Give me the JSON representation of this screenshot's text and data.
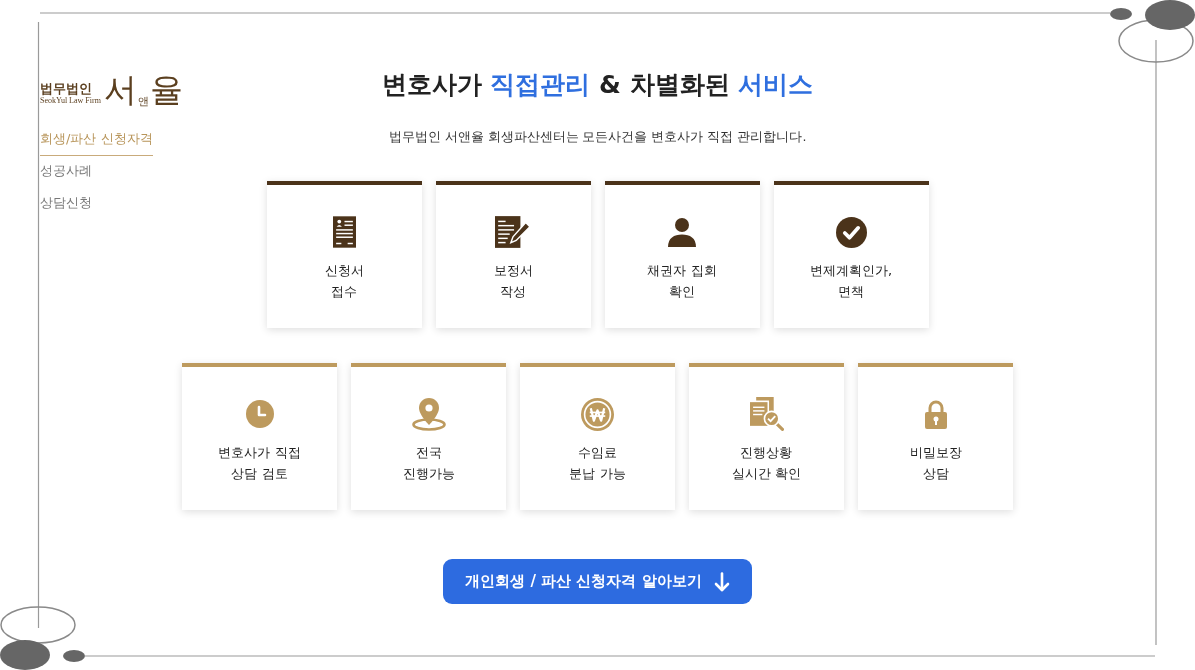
{
  "logo": {
    "firm_type": "법무법인",
    "english_name": "SeokYul Law Firm",
    "name_chars": [
      {
        "text": "서",
        "kind": "large"
      },
      {
        "text": "앤",
        "kind": "small"
      },
      {
        "text": "율",
        "kind": "large"
      }
    ]
  },
  "sidebar": {
    "items": [
      {
        "label": "회생/파산 신청자격",
        "selected": true
      },
      {
        "label": "성공사례",
        "selected": false
      },
      {
        "label": "상담신청",
        "selected": false
      }
    ]
  },
  "heading": {
    "segments": [
      {
        "text": "변호사가 ",
        "highlight": false
      },
      {
        "text": "직접관리",
        "highlight": true
      },
      {
        "text": " & 차별화된 ",
        "highlight": false
      },
      {
        "text": "서비스",
        "highlight": true
      }
    ]
  },
  "subtitle": "법무법인 서앤율 회생파산센터는 모든사건을 변호사가 직접 관리합니다.",
  "card_rows": [
    {
      "kind": "primary",
      "cards": [
        {
          "lines": [
            "신청서",
            "접수"
          ]
        },
        {
          "lines": [
            "보정서",
            "작성"
          ]
        },
        {
          "lines": [
            "채권자 집회",
            "확인"
          ]
        },
        {
          "lines": [
            "변제계획인가,",
            "면책"
          ]
        }
      ]
    },
    {
      "kind": "secondary",
      "cards": [
        {
          "lines": [
            "변호사가 직접",
            "상담 검토"
          ]
        },
        {
          "lines": [
            "전국",
            "진행가능"
          ]
        },
        {
          "lines": [
            "수임료",
            "분납 가능"
          ]
        },
        {
          "lines": [
            "진행상황",
            "실시간 확인"
          ]
        },
        {
          "lines": [
            "비밀보장",
            "상담"
          ]
        }
      ]
    }
  ],
  "cta_button": {
    "label": "개인회생 / 파산 신청자격 알아보기"
  }
}
